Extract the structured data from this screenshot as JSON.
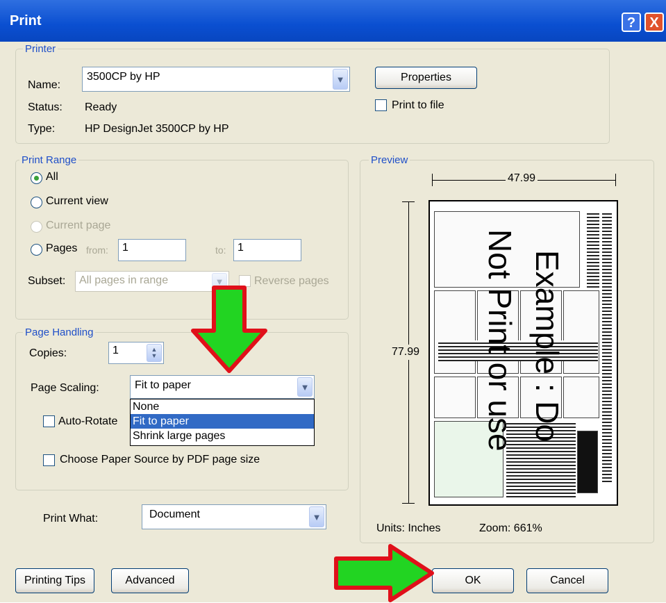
{
  "window": {
    "title": "Print"
  },
  "title_buttons": {
    "help": "?",
    "close": "X"
  },
  "printer": {
    "group_label": "Printer",
    "name_label": "Name:",
    "name_value": "3500CP by HP",
    "status_label": "Status:",
    "status_value": "Ready",
    "type_label": "Type:",
    "type_value": "HP DesignJet 3500CP by HP",
    "properties_button": "Properties",
    "print_to_file": "Print to file"
  },
  "print_range": {
    "group_label": "Print Range",
    "all": "All",
    "current_view": "Current view",
    "current_page": "Current page",
    "pages": "Pages",
    "from_label": "from:",
    "from_value": "1",
    "to_label": "to:",
    "to_value": "1",
    "subset_label": "Subset:",
    "subset_value": "All pages in range",
    "reverse_pages": "Reverse pages"
  },
  "page_handling": {
    "group_label": "Page Handling",
    "copies_label": "Copies:",
    "copies_value": "1",
    "scaling_label": "Page Scaling:",
    "scaling_value": "Fit to paper",
    "scaling_options": [
      "None",
      "Fit to paper",
      "Shrink large pages"
    ],
    "scaling_selected_index": 1,
    "auto_rotate": "Auto-Rotate",
    "choose_paper_source": "Choose Paper Source by PDF page size"
  },
  "print_what": {
    "label": "Print What:",
    "value": "Document"
  },
  "preview": {
    "group_label": "Preview",
    "width": "47.99",
    "height": "77.99",
    "watermark_1": "Example : Do",
    "watermark_2": "Not Print or use",
    "units": "Units: Inches",
    "zoom": "Zoom: 661%"
  },
  "footer": {
    "printing_tips": "Printing Tips",
    "advanced": "Advanced",
    "ok": "OK",
    "cancel": "Cancel"
  },
  "colors": {
    "title_bar": "#0a4fd1",
    "dialog_bg": "#ece9d8",
    "legend": "#1f4fc8",
    "arrow_fill": "#22d422",
    "arrow_stroke": "#e0101a",
    "selection": "#316ac5"
  }
}
